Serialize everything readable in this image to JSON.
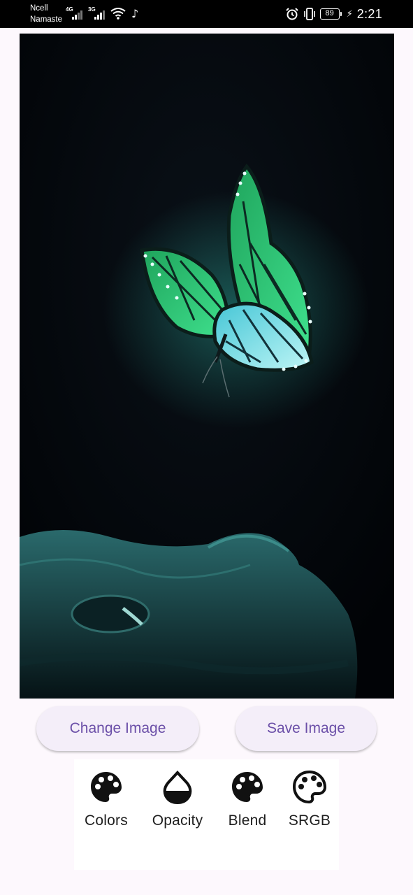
{
  "status_bar": {
    "carrier_1": "Ncell",
    "carrier_2": "Namaste",
    "sim1_network": "4G",
    "sim2_network": "3G",
    "battery_level": "89",
    "time": "2:21",
    "icons": [
      "signal-icon",
      "wifi-icon",
      "music-note-icon",
      "alarm-icon",
      "vibrate-icon",
      "battery-icon",
      "charging-icon"
    ]
  },
  "image_preview": {
    "subject_icons": [
      "butterfly-image",
      "cat-image"
    ]
  },
  "actions": {
    "change_image_label": "Change Image",
    "save_image_label": "Save Image"
  },
  "tools": [
    {
      "label": "Colors",
      "icon": "palette-icon"
    },
    {
      "label": "Opacity",
      "icon": "opacity-drop-icon"
    },
    {
      "label": "Blend",
      "icon": "palette-icon"
    },
    {
      "label": "SRGB",
      "icon": "palette-outline-icon"
    }
  ],
  "colors": {
    "accent_text": "#6b4fa8",
    "button_bg": "#f4eef9",
    "page_bg": "#fdf8fd"
  }
}
